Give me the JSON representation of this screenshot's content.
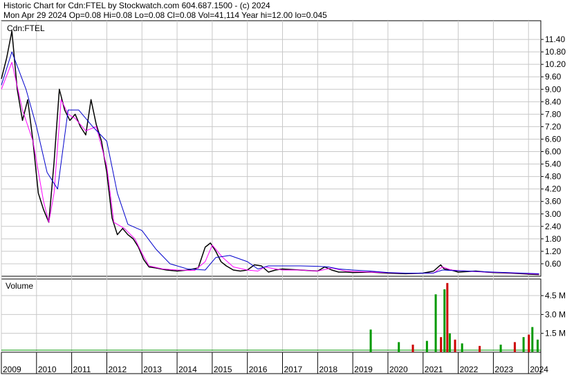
{
  "header": {
    "line1": "Historic Chart for Cdn:FTEL by Stockwatch.com 604.687.1500 - (c) 2024",
    "line2": "Mon Apr 29 2024  Op=0.08  Hi=0.08  Lo=0.08  Cl=0.08  Vol=41,114  Year hi=12.00  lo=0.045"
  },
  "chart_data": [
    {
      "type": "line",
      "title": "Cdn:FTEL",
      "y_ticks": [
        "11.40",
        "10.80",
        "10.20",
        "9.60",
        "9.00",
        "8.40",
        "7.80",
        "7.20",
        "6.60",
        "6.00",
        "5.40",
        "4.80",
        "4.20",
        "3.60",
        "3.00",
        "2.40",
        "1.80",
        "1.20",
        "0.60"
      ],
      "ylim": [
        0,
        12.3
      ],
      "grid": true,
      "series": [
        {
          "color": "#000000",
          "x": [
            2009.0,
            2009.15,
            2009.3,
            2009.45,
            2009.6,
            2009.75,
            2009.9,
            2010.05,
            2010.2,
            2010.35,
            2010.5,
            2010.65,
            2010.8,
            2010.95,
            2011.1,
            2011.25,
            2011.4,
            2011.55,
            2011.7,
            2011.85,
            2012.0,
            2012.15,
            2012.3,
            2012.45,
            2012.6,
            2012.75,
            2012.9,
            2013.05,
            2013.2,
            2013.4,
            2013.7,
            2014.0,
            2014.3,
            2014.6,
            2014.8,
            2014.95,
            2015.1,
            2015.25,
            2015.4,
            2015.6,
            2015.8,
            2016.0,
            2016.2,
            2016.4,
            2016.6,
            2016.8,
            2017.0,
            2017.5,
            2018.0,
            2018.2,
            2018.4,
            2018.6,
            2018.8,
            2019.0,
            2019.5,
            2020.0,
            2020.5,
            2021.0,
            2021.3,
            2021.5,
            2021.6,
            2021.8,
            2022.0,
            2022.5,
            2022.8,
            2023.0,
            2023.5,
            2024.0,
            2024.3
          ],
          "values": [
            9.5,
            10.5,
            11.8,
            9.0,
            7.5,
            8.5,
            6.5,
            4.0,
            3.2,
            2.6,
            5.5,
            9.0,
            8.0,
            7.5,
            7.8,
            7.2,
            6.8,
            8.5,
            7.3,
            6.5,
            5.0,
            2.8,
            2.0,
            2.3,
            2.0,
            1.8,
            1.4,
            0.8,
            0.45,
            0.4,
            0.3,
            0.25,
            0.3,
            0.4,
            1.4,
            1.6,
            1.2,
            0.7,
            0.5,
            0.3,
            0.25,
            0.3,
            0.55,
            0.5,
            0.2,
            0.3,
            0.35,
            0.3,
            0.25,
            0.45,
            0.3,
            0.2,
            0.2,
            0.18,
            0.2,
            0.15,
            0.12,
            0.15,
            0.25,
            0.55,
            0.35,
            0.3,
            0.2,
            0.25,
            0.2,
            0.18,
            0.15,
            0.1,
            0.08
          ]
        },
        {
          "color": "#ff00ff",
          "x": [
            2009.0,
            2009.3,
            2009.6,
            2009.9,
            2010.2,
            2010.35,
            2010.5,
            2010.7,
            2010.9,
            2011.1,
            2011.4,
            2011.7,
            2012.0,
            2012.2,
            2012.5,
            2012.8,
            2013.0,
            2013.2,
            2013.6,
            2014.0,
            2014.5,
            2014.8,
            2015.0,
            2015.3,
            2015.6,
            2016.0,
            2016.3,
            2016.5,
            2016.8,
            2017.0,
            2017.5,
            2018.0,
            2018.4,
            2018.8,
            2019.5,
            2020.5,
            2021.3,
            2021.55,
            2021.8,
            2022.5,
            2023.5,
            2024.3
          ],
          "values": [
            9.0,
            10.3,
            8.0,
            6.5,
            3.6,
            2.6,
            4.0,
            8.5,
            7.8,
            7.6,
            7.0,
            7.2,
            5.3,
            2.6,
            2.3,
            1.8,
            1.1,
            0.5,
            0.35,
            0.3,
            0.28,
            0.7,
            1.5,
            0.9,
            0.45,
            0.3,
            0.25,
            0.45,
            0.35,
            0.3,
            0.3,
            0.25,
            0.4,
            0.25,
            0.2,
            0.14,
            0.15,
            0.45,
            0.3,
            0.22,
            0.16,
            0.1
          ]
        },
        {
          "color": "#0000cc",
          "x": [
            2009.0,
            2009.3,
            2009.7,
            2010.0,
            2010.3,
            2010.6,
            2010.9,
            2011.2,
            2011.6,
            2012.0,
            2012.3,
            2012.6,
            2013.0,
            2013.4,
            2013.8,
            2014.3,
            2014.8,
            2015.1,
            2015.5,
            2016.0,
            2016.3,
            2016.6,
            2017.0,
            2017.5,
            2018.0,
            2018.3,
            2018.6,
            2019.0,
            2019.5,
            2020.0,
            2020.5,
            2021.0,
            2021.3,
            2021.55,
            2021.8,
            2022.3,
            2023.0,
            2023.5,
            2024.3
          ],
          "values": [
            9.2,
            10.8,
            9.0,
            7.2,
            5.0,
            4.2,
            8.0,
            8.0,
            7.2,
            6.5,
            4.0,
            2.5,
            2.2,
            1.3,
            0.6,
            0.35,
            0.3,
            0.9,
            1.0,
            0.7,
            0.35,
            0.5,
            0.5,
            0.5,
            0.48,
            0.45,
            0.35,
            0.3,
            0.25,
            0.18,
            0.15,
            0.15,
            0.16,
            0.3,
            0.28,
            0.25,
            0.2,
            0.17,
            0.12
          ]
        }
      ]
    },
    {
      "type": "bar",
      "title": "Volume",
      "y_ticks": [
        "4.5 M",
        "3.0 M",
        "1.5 M"
      ],
      "ylim": [
        0,
        5.6
      ],
      "bars": [
        {
          "x": 2019.5,
          "value": 1.8,
          "color": "#009900"
        },
        {
          "x": 2020.3,
          "value": 0.8,
          "color": "#009900"
        },
        {
          "x": 2020.7,
          "value": 0.6,
          "color": "#cc0000"
        },
        {
          "x": 2021.1,
          "value": 0.9,
          "color": "#009900"
        },
        {
          "x": 2021.35,
          "value": 4.6,
          "color": "#009900"
        },
        {
          "x": 2021.5,
          "value": 1.2,
          "color": "#cc0000"
        },
        {
          "x": 2021.6,
          "value": 5.0,
          "color": "#009900"
        },
        {
          "x": 2021.68,
          "value": 5.5,
          "color": "#cc0000"
        },
        {
          "x": 2021.75,
          "value": 1.5,
          "color": "#009900"
        },
        {
          "x": 2021.9,
          "value": 1.0,
          "color": "#cc0000"
        },
        {
          "x": 2022.1,
          "value": 0.7,
          "color": "#009900"
        },
        {
          "x": 2022.6,
          "value": 0.5,
          "color": "#cc0000"
        },
        {
          "x": 2023.2,
          "value": 0.6,
          "color": "#009900"
        },
        {
          "x": 2023.6,
          "value": 0.8,
          "color": "#cc0000"
        },
        {
          "x": 2023.85,
          "value": 1.2,
          "color": "#009900"
        },
        {
          "x": 2024.0,
          "value": 1.4,
          "color": "#cc0000"
        },
        {
          "x": 2024.1,
          "value": 2.0,
          "color": "#009900"
        },
        {
          "x": 2024.25,
          "value": 1.0,
          "color": "#009900"
        }
      ]
    }
  ],
  "x_axis": {
    "years": [
      "2009",
      "2010",
      "2011",
      "2012",
      "2013",
      "2014",
      "2015",
      "2016",
      "2017",
      "2018",
      "2019",
      "2020",
      "2021",
      "2022",
      "2023",
      "2024"
    ],
    "start": 2009.0,
    "end": 2024.35
  }
}
